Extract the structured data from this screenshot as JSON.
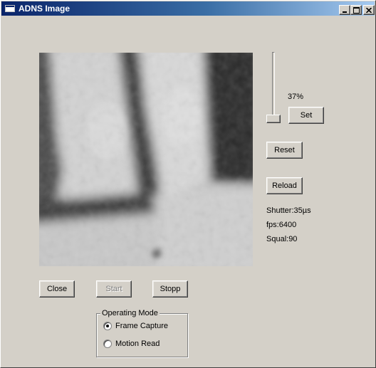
{
  "window": {
    "title": "ADNS Image",
    "caption_buttons": [
      "minimize-icon",
      "maximize-icon",
      "close-icon"
    ]
  },
  "slider": {
    "value_label": "37%",
    "orientation": "vertical"
  },
  "buttons": {
    "set": "Set",
    "reset": "Reset",
    "reload": "Reload",
    "close": "Close",
    "start": "Start",
    "stopp": "Stopp"
  },
  "stats": {
    "shutter": "Shutter:35µs",
    "fps": "fps:6400",
    "squal": "Squal:90"
  },
  "operating_mode": {
    "title": "Operating Mode",
    "options": [
      {
        "label": "Frame Capture",
        "checked": true
      },
      {
        "label": "Motion Read",
        "checked": false
      }
    ]
  },
  "colors": {
    "titlebar_start": "#0a246a",
    "titlebar_end": "#a6caf0",
    "face": "#d4d0c8",
    "disabled_text": "#808080"
  }
}
